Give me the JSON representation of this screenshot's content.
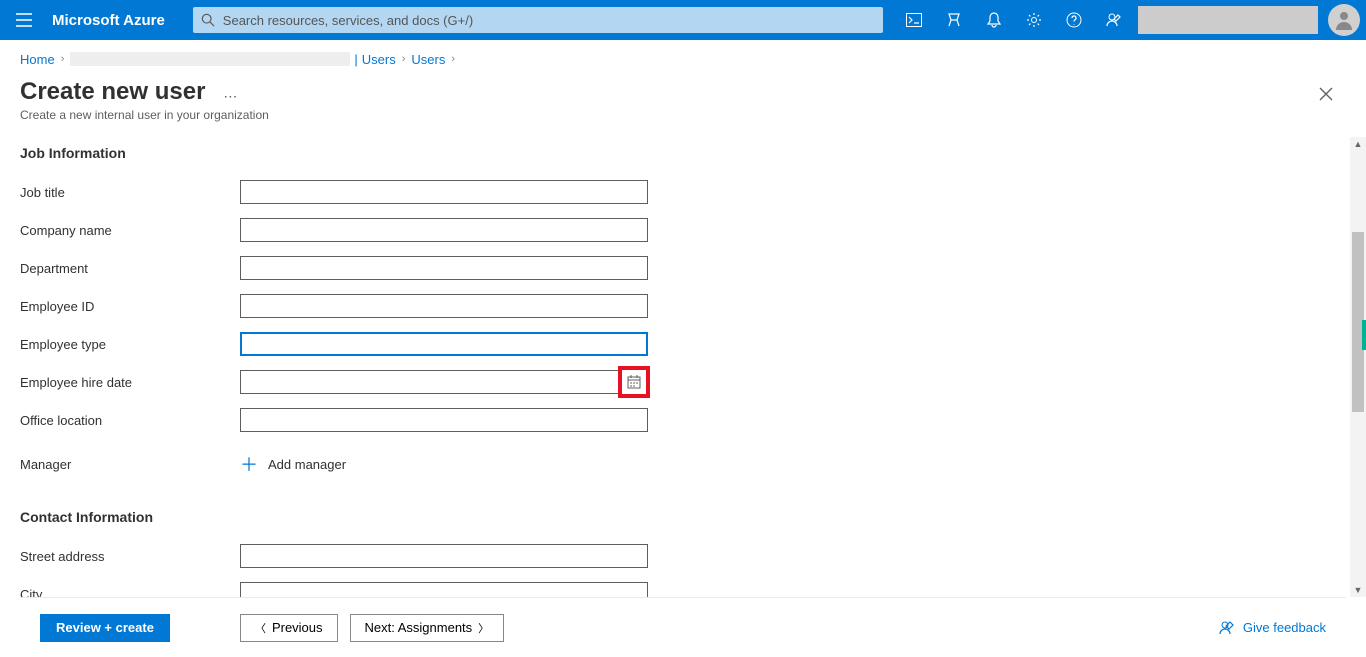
{
  "header": {
    "brand": "Microsoft Azure",
    "search_placeholder": "Search resources, services, and docs (G+/)"
  },
  "breadcrumb": {
    "home": "Home",
    "users1": "Users",
    "users2": "Users"
  },
  "page": {
    "title": "Create new user",
    "subtitle": "Create a new internal user in your organization"
  },
  "sections": {
    "job": "Job Information",
    "contact": "Contact Information"
  },
  "fields": {
    "job_title": {
      "label": "Job title",
      "value": ""
    },
    "company_name": {
      "label": "Company name",
      "value": ""
    },
    "department": {
      "label": "Department",
      "value": ""
    },
    "employee_id": {
      "label": "Employee ID",
      "value": ""
    },
    "employee_type": {
      "label": "Employee type",
      "value": ""
    },
    "employee_hire_date": {
      "label": "Employee hire date",
      "value": ""
    },
    "office_location": {
      "label": "Office location",
      "value": ""
    },
    "manager": {
      "label": "Manager",
      "action": "Add manager"
    },
    "street_address": {
      "label": "Street address",
      "value": ""
    },
    "city": {
      "label": "City",
      "value": ""
    }
  },
  "footer": {
    "review": "Review + create",
    "previous": "Previous",
    "next": "Next: Assignments",
    "feedback": "Give feedback"
  }
}
